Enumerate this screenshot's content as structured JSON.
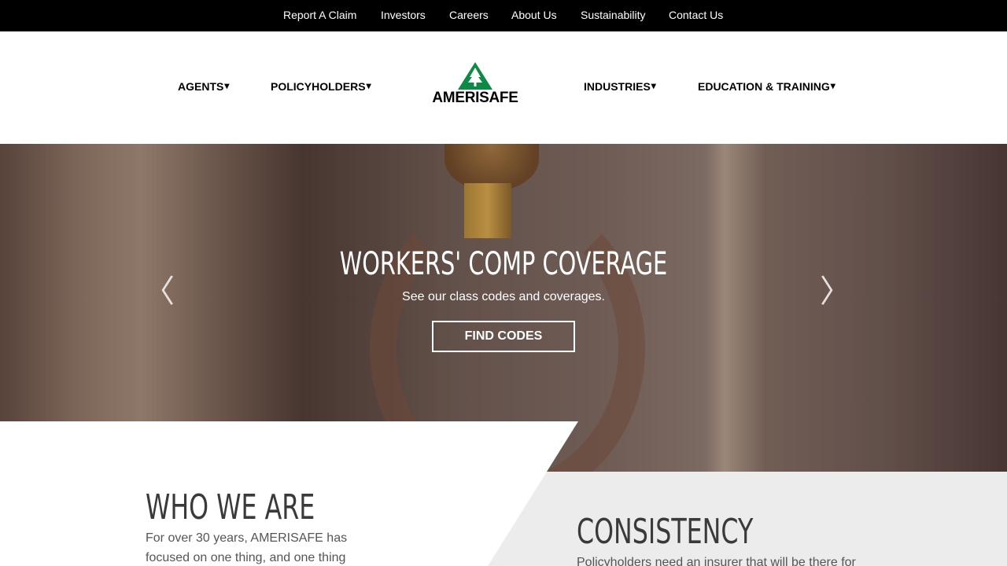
{
  "topbar": {
    "links": [
      "Report A Claim",
      "Investors",
      "Careers",
      "About Us",
      "Sustainability",
      "Contact Us"
    ]
  },
  "nav": {
    "agents": "AGENTS",
    "policyholders": "POLICYHOLDERS",
    "industries": "INDUSTRIES",
    "education": "EDUCATION & TRAINING",
    "caret": "▾",
    "logo_text": "AMERISAFE",
    "logo_color": "#0f8a45"
  },
  "hero": {
    "title": "WORKERS' COMP COVERAGE",
    "subtitle": "See our class codes and coverages.",
    "button": "FIND CODES",
    "prev": "〈",
    "next": "〉"
  },
  "who": {
    "title": "WHO WE ARE",
    "text": "For over 30 years, AMERISAFE has focused on one thing, and one thing"
  },
  "consistency": {
    "title": "CONSISTENCY",
    "text": "Policyholders need an insurer that will be there for"
  }
}
